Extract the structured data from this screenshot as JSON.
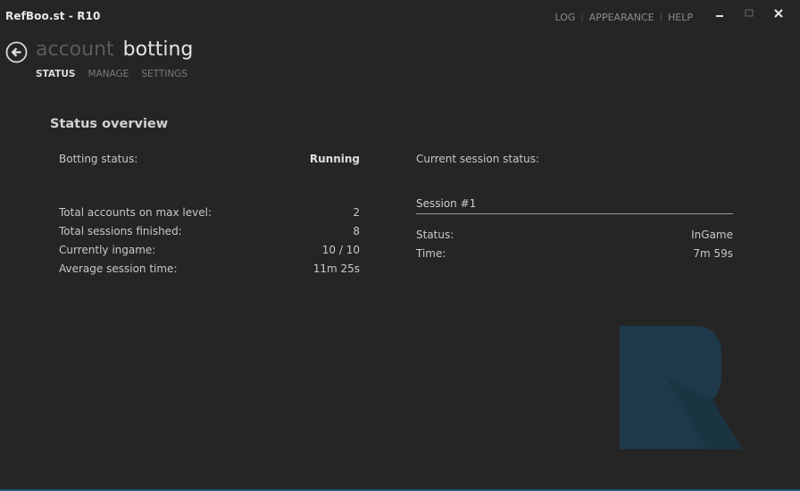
{
  "app": {
    "title": "RefBoo.st - R10"
  },
  "top_menu": {
    "items": [
      "LOG",
      "APPEARANCE",
      "HELP"
    ],
    "separator": "|"
  },
  "window_controls": {
    "minimize": "minimize-icon",
    "maximize": "maximize-icon",
    "close": "close-icon"
  },
  "header": {
    "back_icon": "back-arrow-icon",
    "title_dim": "account",
    "title_bright": "botting"
  },
  "tabs": [
    {
      "label": "STATUS",
      "active": true
    },
    {
      "label": "MANAGE",
      "active": false
    },
    {
      "label": "SETTINGS",
      "active": false
    }
  ],
  "overview": {
    "title": "Status overview",
    "botting_status": {
      "label": "Botting status:",
      "value": "Running"
    },
    "stats": [
      {
        "label": "Total accounts on max level:",
        "value": "2"
      },
      {
        "label": "Total sessions finished:",
        "value": "8"
      },
      {
        "label": "Currently ingame:",
        "value": "10 / 10"
      },
      {
        "label": "Average session time:",
        "value": "11m 25s"
      }
    ]
  },
  "current_session": {
    "label": "Current session status:",
    "session_name": "Session #1",
    "status": {
      "label": "Status:",
      "value": "InGame"
    },
    "time": {
      "label": "Time:",
      "value": "7m 59s"
    }
  },
  "colors": {
    "background": "#252526",
    "logo": "#1e3a4a",
    "accent": "#1f5a75"
  }
}
